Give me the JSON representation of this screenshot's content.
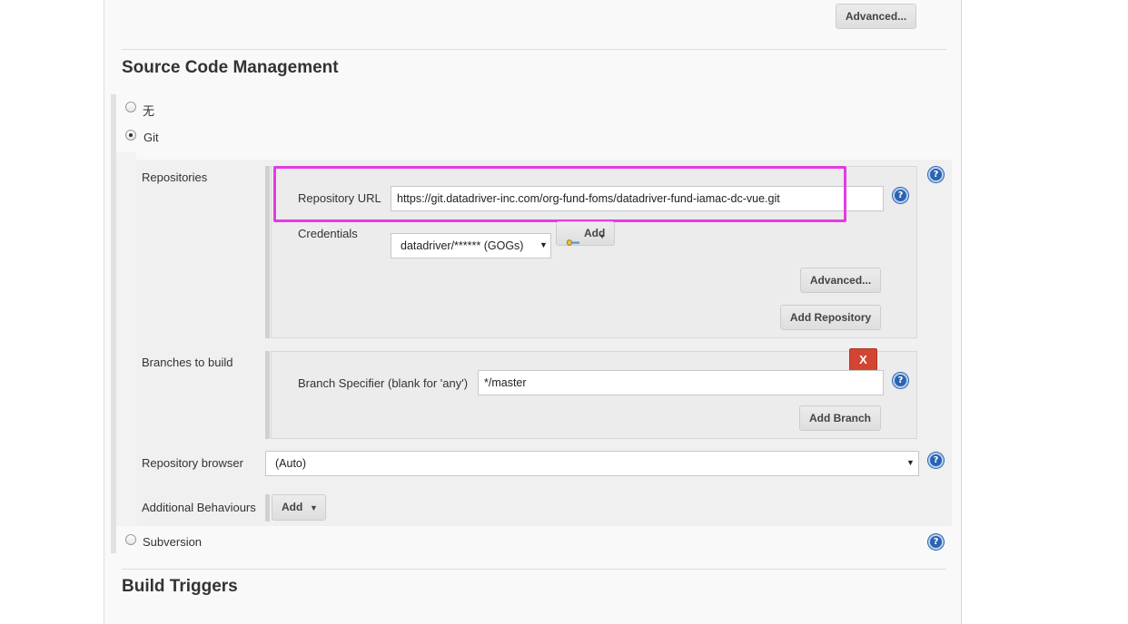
{
  "top": {
    "advanced_button": "Advanced..."
  },
  "scm": {
    "title": "Source Code Management",
    "options": {
      "none_label": "无",
      "git_label": "Git",
      "subversion_label": "Subversion",
      "selected": "Git"
    },
    "repositories": {
      "label": "Repositories",
      "url_label": "Repository URL",
      "url_value": "https://git.datadriver-inc.com/org-fund-foms/datadriver-fund-iamac-dc-vue.git",
      "credentials_label": "Credentials",
      "credentials_value": "datadriver/****** (GOGs)",
      "add_credentials_button": "Add",
      "advanced_button": "Advanced...",
      "add_repository_button": "Add Repository"
    },
    "branches": {
      "label": "Branches to build",
      "delete_button": "X",
      "specifier_label": "Branch Specifier (blank for 'any')",
      "specifier_value": "*/master",
      "add_branch_button": "Add Branch"
    },
    "repository_browser": {
      "label": "Repository browser",
      "value": "(Auto)"
    },
    "additional_behaviours": {
      "label": "Additional Behaviours",
      "add_button": "Add"
    }
  },
  "build_triggers": {
    "title": "Build Triggers"
  },
  "help_icon_glyph": "?",
  "colors": {
    "highlight": "#e43be4",
    "help_icon": "#2a63b2",
    "delete_button": "#d24533"
  }
}
